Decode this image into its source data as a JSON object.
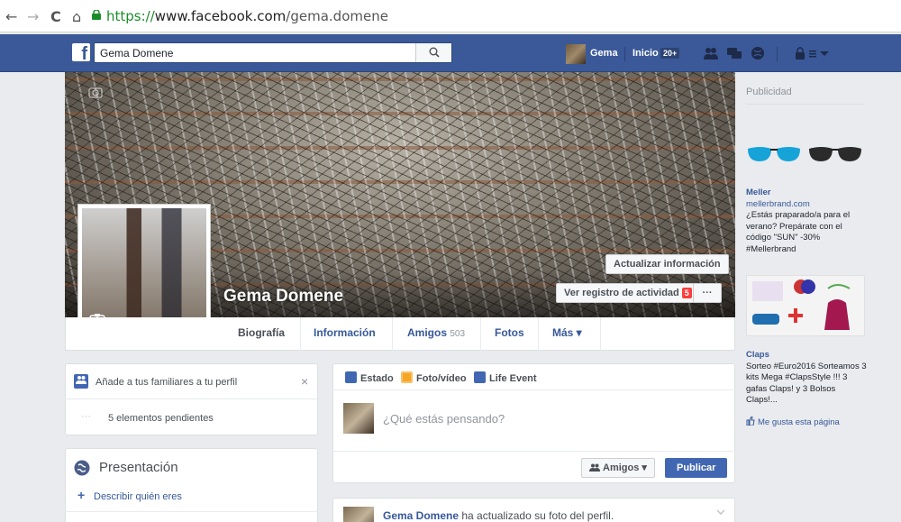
{
  "browser": {
    "url_scheme": "https://",
    "url_host": "www.facebook.com",
    "url_path": "/gema.domene",
    "back_glyph": "←",
    "forward_glyph": "→",
    "reload_glyph": "C",
    "home_glyph": "⌂"
  },
  "topbar": {
    "search_value": "Gema Domene",
    "user_name": "Gema",
    "home_label": "Inicio",
    "home_count": "20+"
  },
  "profile": {
    "name": "Gema Domene",
    "update_info_button": "Actualizar información",
    "activity_log_button": "Ver registro de actividad",
    "activity_log_count": "5",
    "more_dots": "···"
  },
  "tabs": [
    {
      "label": "Biografía"
    },
    {
      "label": "Información"
    },
    {
      "label": "Amigos",
      "count": "503"
    },
    {
      "label": "Fotos"
    },
    {
      "label": "Más ▾"
    }
  ],
  "left": {
    "family_prompt": "Añade a tus familiares a tu perfil",
    "close_glyph": "×",
    "pending_dots": "···",
    "pending_text": "5 elementos pendientes",
    "intro_title": "Presentación",
    "describe_plus": "+",
    "describe_link": "Describir quién eres"
  },
  "composer": {
    "tab_status": "Estado",
    "tab_photo": "Foto/vídeo",
    "tab_event": "Life Event",
    "placeholder": "¿Qué estás pensando?",
    "audience": "Amigos ▾",
    "publish": "Publicar"
  },
  "feed": {
    "post_author": "Gema Domene",
    "post_action": "ha actualizado su foto del perfil."
  },
  "ads": {
    "header": "Publicidad",
    "items": [
      {
        "title": "Meller",
        "domain": "mellerbrand.com",
        "body": "¿Estás praparado/a para el verano? Prepárate con el código \"SUN\" -30% #Mellerbrand"
      },
      {
        "title": "Claps",
        "body": "Sorteo #Euro2016 Sorteamos 3 kits Mega #ClapsStyle !!! 3 gafas Claps! y 3 Bolsos Claps!...",
        "like": "Me gusta esta página"
      }
    ]
  },
  "colors": {
    "fb_blue": "#3b5998",
    "link": "#365899",
    "page_bg": "#e9ebee"
  }
}
